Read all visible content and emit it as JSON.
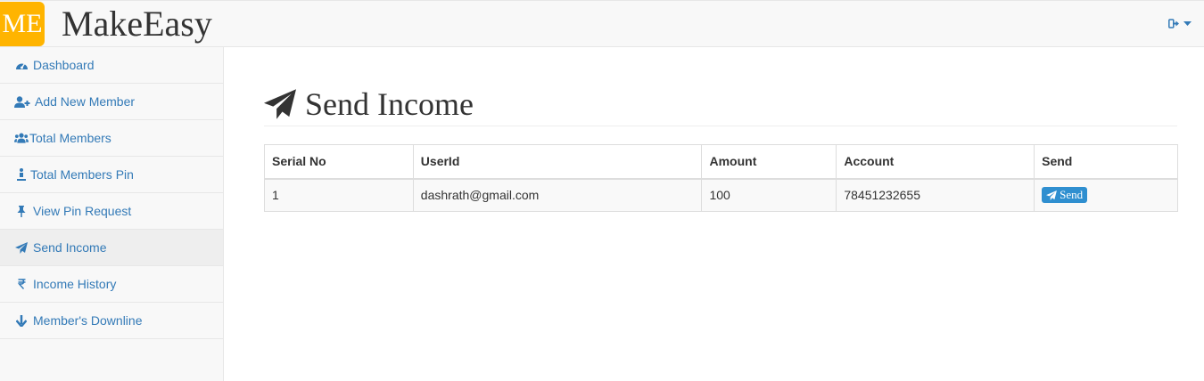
{
  "app": {
    "logo_text": "ME",
    "brand": "MakeEasy"
  },
  "sidebar": {
    "items": [
      {
        "label": "Dashboard",
        "icon": "dashboard-icon"
      },
      {
        "label": "Add New Member",
        "icon": "user-plus-icon"
      },
      {
        "label": "Total Members",
        "icon": "users-icon"
      },
      {
        "label": "Total Members Pin",
        "icon": "person-pin-icon"
      },
      {
        "label": "View Pin Request",
        "icon": "thumbtack-icon"
      },
      {
        "label": "Send Income",
        "icon": "paper-plane-icon",
        "active": true
      },
      {
        "label": "Income History",
        "icon": "rupee-icon"
      },
      {
        "label": "Member's Downline",
        "icon": "arrow-down-icon"
      }
    ]
  },
  "page": {
    "title": "Send Income"
  },
  "table": {
    "headers": [
      "Serial No",
      "UserId",
      "Amount",
      "Account",
      "Send"
    ],
    "rows": [
      {
        "serial": "1",
        "userid": "dashrath@gmail.com",
        "amount": "100",
        "account": "78451232655",
        "send_label": "Send"
      }
    ]
  },
  "colors": {
    "accent": "#337ab7",
    "logo_bg": "#ffb400",
    "button_bg": "#2f8fd0"
  }
}
